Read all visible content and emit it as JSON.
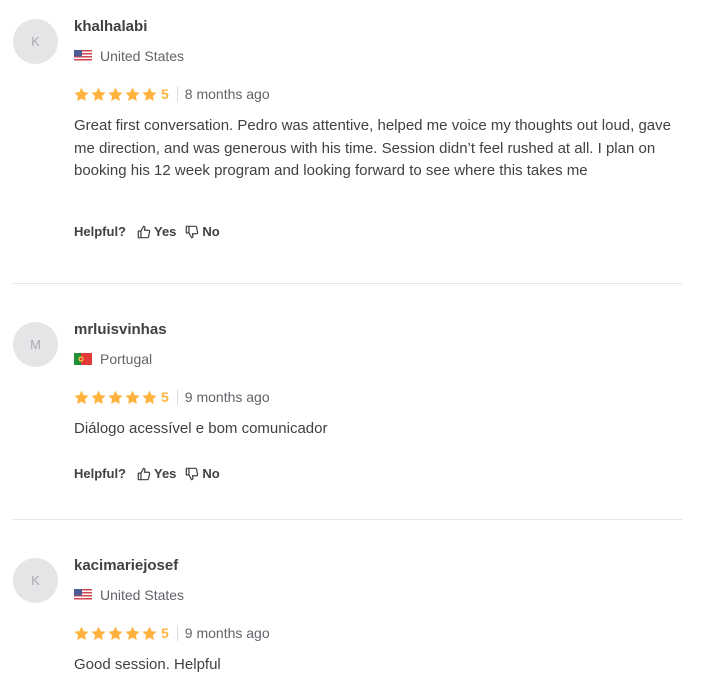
{
  "ui": {
    "helpful_label": "Helpful?",
    "yes_label": "Yes",
    "no_label": "No"
  },
  "colors": {
    "star": "#ffb33e",
    "avatar_bg": "#e4e5e7",
    "divider": "#e4e5e7"
  },
  "reviews": [
    {
      "initial": "K",
      "username": "khalhalabi",
      "country": "United States",
      "flag_icon": "us-flag-icon",
      "rating": "5",
      "stars": 5,
      "time_ago": "8 months ago",
      "text": "Great first conversation. Pedro was attentive, helped me voice my thoughts out loud, gave me direction, and was generous with his time. Session didn’t feel rushed at all. I plan on booking his 12 week program and looking forward to see where this takes me"
    },
    {
      "initial": "M",
      "username": "mrluisvinhas",
      "country": "Portugal",
      "flag_icon": "pt-flag-icon",
      "rating": "5",
      "stars": 5,
      "time_ago": "9 months ago",
      "text": "Diálogo acessível e bom comunicador"
    },
    {
      "initial": "K",
      "username": "kacimariejosef",
      "country": "United States",
      "flag_icon": "us-flag-icon",
      "rating": "5",
      "stars": 5,
      "time_ago": "9 months ago",
      "text": "Good session. Helpful"
    }
  ]
}
